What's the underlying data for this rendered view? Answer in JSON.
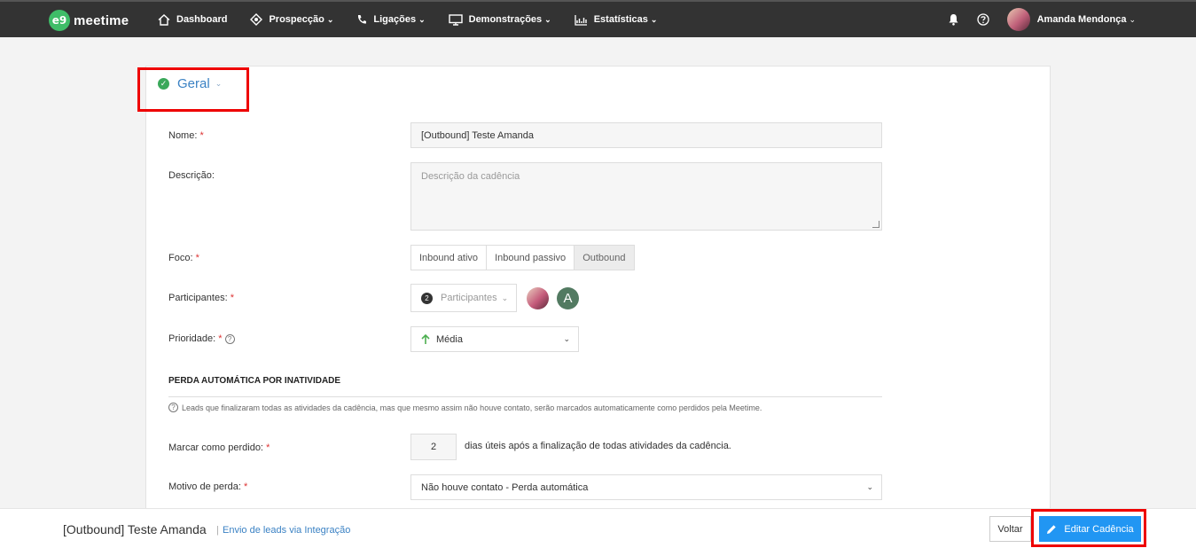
{
  "nav": {
    "logo_badge": "e9",
    "logo_text": "meetime",
    "items": [
      {
        "label": "Dashboard",
        "icon": "home-icon"
      },
      {
        "label": "Prospecção",
        "icon": "target-icon"
      },
      {
        "label": "Ligações",
        "icon": "phone-icon"
      },
      {
        "label": "Demonstrações",
        "icon": "monitor-icon"
      },
      {
        "label": "Estatísticas",
        "icon": "chart-icon"
      }
    ],
    "user_name": "Amanda Mendonça"
  },
  "section": {
    "title": "Geral"
  },
  "form": {
    "nome_label": "Nome:",
    "nome_value": "[Outbound] Teste Amanda",
    "descricao_label": "Descrição:",
    "descricao_placeholder": "Descrição da cadência",
    "foco_label": "Foco:",
    "foco_options": [
      "Inbound ativo",
      "Inbound passivo",
      "Outbound"
    ],
    "foco_selected": "Outbound",
    "participantes_label": "Participantes:",
    "participantes_count": "2",
    "participantes_button": "Participantes",
    "participante_initial": "A",
    "prioridade_label": "Prioridade:",
    "prioridade_value": "Média",
    "perda_heading": "PERDA AUTOMÁTICA POR INATIVIDADE",
    "perda_hint": "Leads que finalizaram todas as atividades da cadência, mas que mesmo assim não houve contato, serão marcados automaticamente como perdidos pela Meetime.",
    "marcar_label": "Marcar como perdido:",
    "marcar_value": "2",
    "marcar_suffix": "dias úteis após a finalização de todas atividades da cadência.",
    "motivo_label": "Motivo de perda:",
    "motivo_value": "Não houve contato - Perda automática",
    "required_mark": "*"
  },
  "footer": {
    "title": "[Outbound] Teste Amanda",
    "separator": "|",
    "subtitle": "Envio de leads via Integração",
    "voltar_label": "Voltar",
    "edit_label": "Editar Cadência"
  },
  "colors": {
    "topbar": "#333333",
    "accent_blue": "#2196f3",
    "success_green": "#3aa85a",
    "highlight_red": "#ee0000"
  }
}
